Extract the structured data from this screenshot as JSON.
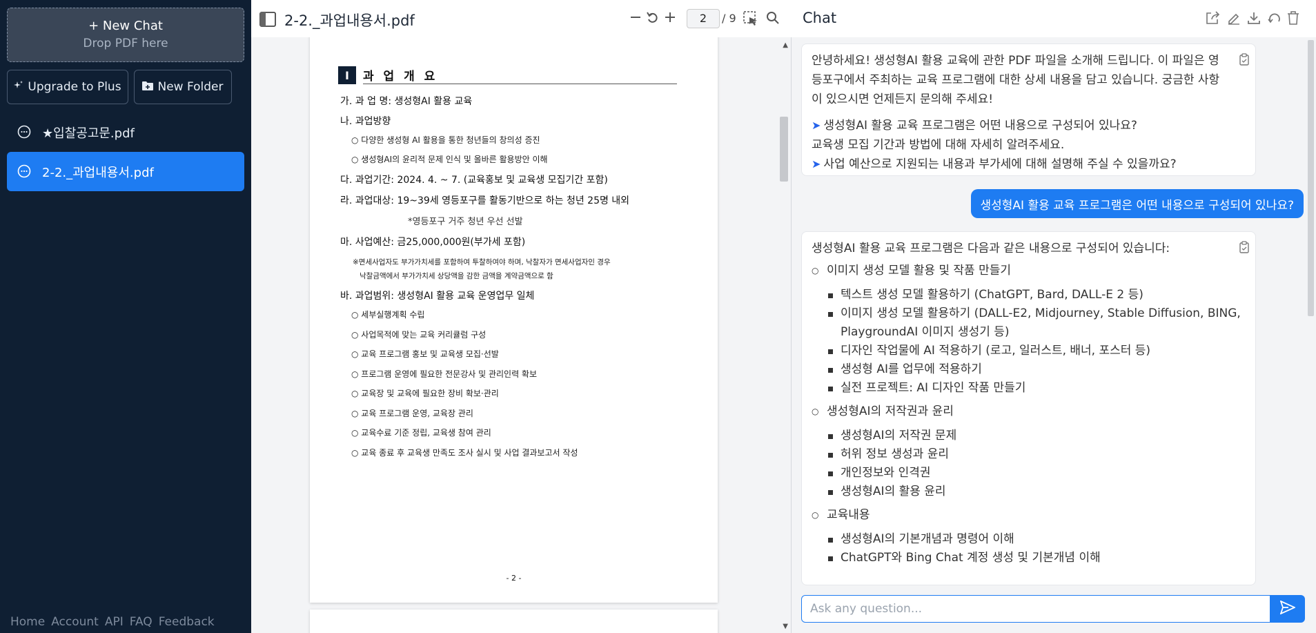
{
  "sidebar": {
    "new_chat_label": "+ New Chat",
    "drop_hint": "Drop PDF here",
    "upgrade_label": "Upgrade to Plus",
    "new_folder_label": "New Folder",
    "files": [
      {
        "label": "★입찰공고문.pdf",
        "active": false
      },
      {
        "label": "2-2._과업내용서.pdf",
        "active": true
      }
    ],
    "footer_links": [
      "Home",
      "Account",
      "API",
      "FAQ",
      "Feedback"
    ]
  },
  "pdf": {
    "title": "2-2._과업내용서.pdf",
    "current_page": "2",
    "total_pages": "/ 9",
    "section_number": "I",
    "section_title": "과 업 개 요",
    "lines": [
      "가. 과 업 명: 생성형AI 활용 교육",
      "나. 과업방향",
      "○  다양한 생성형 AI 활용을 통한 청년들의 창의성 증진",
      "○  생성형AI의 윤리적 문제 인식 및 올바른 활용방안 이해",
      "다. 과업기간: 2024. 4. ~ 7. (교육홍보 및 교육생 모집기간 포함)",
      "라. 과업대상: 19~39세 영등포구를 활동기반으로 하는 청년 25명 내외",
      "*영등포구 거주 청년 우선 선발",
      "마. 사업예산: 금25,000,000원(부가세 포함)",
      "※면세사업자도 부가가치세를 포함하여 투찰하여야 하며, 낙찰자가 면세사업자인 경우",
      "낙찰금액에서 부가가치세 상당액을 감한 금액을 계약금액으로 함",
      "바. 과업범위: 생성형AI 활용 교육 운영업무 일체",
      "○  세부실행계획 수립",
      "○  사업목적에 맞는 교육 커리큘럼 구성",
      "○  교육 프로그램 홍보 및 교육생 모집·선발",
      "○  프로그램 운영에 필요한 전문강사 및 관리인력 확보",
      "○  교육장 및 교육에 필요한 장비 확보·관리",
      "○  교육 프로그램 운영, 교육장 관리",
      "○  교육수료 기준 정립, 교육생 참여 관리",
      "○  교육 종료 후 교육생 만족도 조사 실시 및 사업 결과보고서 작성"
    ],
    "page_number": "- 2 -"
  },
  "chat": {
    "title": "Chat",
    "intro": "안녕하세요! 생성형AI 활용 교육에 관한 PDF 파일을 소개해 드립니다. 이 파일은 영등포구에서 주최하는 교육 프로그램에 대한 상세 내용을 담고 있습니다. 궁금한 사항이 있으시면 언제든지 문의해 주세요!",
    "suggestions": [
      "생성형AI 활용 교육 프로그램은 어떤 내용으로 구성되어 있나요?",
      "교육생 모집 기간과 방법에 대해 자세히 알려주세요.",
      "사업 예산으로 지원되는 내용과 부가세에 대해 설명해 주실 수 있을까요?"
    ],
    "user_message": "생성형AI 활용 교육 프로그램은 어떤 내용으로 구성되어 있나요?",
    "answer_intro": "생성형AI 활용 교육 프로그램은 다음과 같은 내용으로 구성되어 있습니다:",
    "answer_sections": [
      {
        "title": "이미지 생성 모델 활용 및 작품 만들기",
        "items": [
          "텍스트 생성 모델 활용하기 (ChatGPT, Bard, DALL-E 2 등)",
          "이미지 생성 모델 활용하기 (DALL-E2, Midjourney, Stable Diffusion, BING, PlaygroundAI 이미지 생성기 등)",
          "디자인 작업물에 AI 적용하기 (로고, 일러스트, 배너, 포스터 등)",
          "생성형 AI를 업무에 적용하기",
          "실전 프로젝트: AI 디자인 작품 만들기"
        ]
      },
      {
        "title": "생성형AI의 저작권과 윤리",
        "items": [
          "생성형AI의 저작권 문제",
          "허위 정보 생성과 윤리",
          "개인정보와 인격권",
          "생성형AI의 활용 윤리"
        ]
      },
      {
        "title": "교육내용",
        "items": [
          "생성형AI의 기본개념과 명령어 이해",
          "ChatGPT와 Bing Chat 계정 생성 및 기본개념 이해"
        ]
      }
    ],
    "input_placeholder": "Ask any question..."
  },
  "colors": {
    "sidebar_bg": "#0f1f33",
    "accent": "#1e7cf2"
  }
}
